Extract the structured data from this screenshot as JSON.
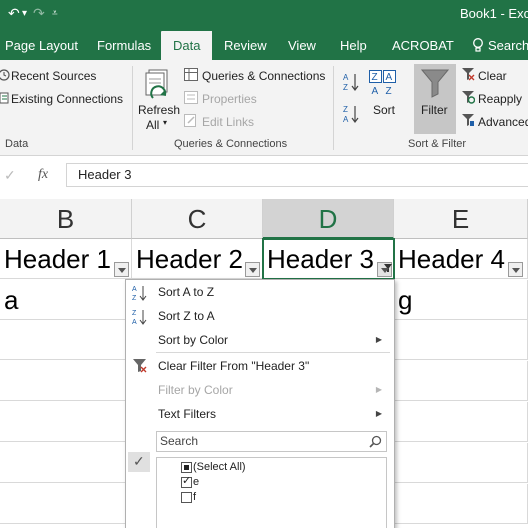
{
  "titlebar": {
    "book": "Book1 - Exc"
  },
  "tabs": [
    "Page Layout",
    "Formulas",
    "Data",
    "Review",
    "View",
    "Help",
    "ACROBAT",
    "Search"
  ],
  "ribbon": {
    "get_data": {
      "recent_sources": "Recent Sources",
      "existing_connections": "Existing Connections",
      "group_label": "Data"
    },
    "queries": {
      "refresh_all_1": "Refresh",
      "refresh_all_2": "All",
      "queries_connections": "Queries & Connections",
      "properties": "Properties",
      "edit_links": "Edit Links",
      "group_label": "Queries & Connections"
    },
    "sort_filter": {
      "sort": "Sort",
      "filter": "Filter",
      "clear": "Clear",
      "reapply": "Reapply",
      "advanced": "Advanced",
      "group_label": "Sort & Filter"
    }
  },
  "formula_bar": {
    "value": "Header 3"
  },
  "columns": [
    "B",
    "C",
    "D",
    "E"
  ],
  "headers": [
    "Header 1",
    "Header 2",
    "Header 3",
    "Header 4"
  ],
  "row2": [
    "a",
    "",
    "",
    "g"
  ],
  "filter_menu": {
    "sort_az": "Sort A to Z",
    "sort_za": "Sort Z to A",
    "sort_by_color": "Sort by Color",
    "clear_filter": "Clear Filter From \"Header 3\"",
    "filter_by_color": "Filter by Color",
    "text_filters": "Text Filters",
    "search_placeholder": "Search",
    "list": [
      {
        "label": "(Select All)",
        "state": "partial"
      },
      {
        "label": "e",
        "state": "checked"
      },
      {
        "label": "f",
        "state": "unchecked"
      }
    ]
  },
  "colors": {
    "excel_green": "#217346",
    "ribbon_bg": "#f3f3f3",
    "selected_header": "#d3d3d3"
  }
}
